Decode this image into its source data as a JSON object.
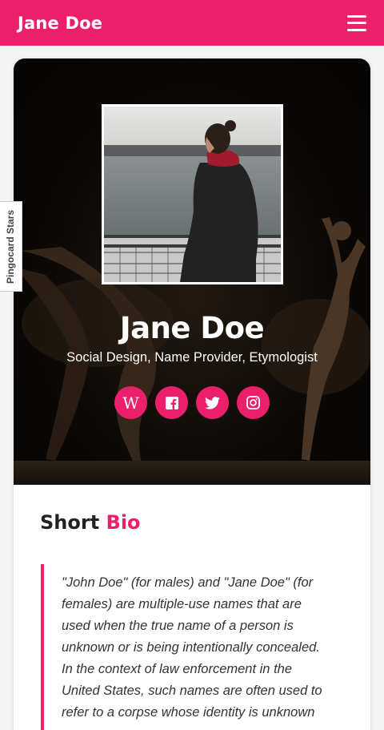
{
  "header": {
    "brand": "Jane Doe",
    "menu_icon": "hamburger-menu-icon"
  },
  "side_tab": {
    "label": "Pingocard Stars"
  },
  "profile": {
    "name": "Jane Doe",
    "tagline": "Social Design, Name Provider, Etymologist",
    "socials": [
      {
        "icon": "wikipedia-icon",
        "glyph": "W"
      },
      {
        "icon": "facebook-icon"
      },
      {
        "icon": "twitter-icon"
      },
      {
        "icon": "instagram-icon"
      }
    ]
  },
  "bio": {
    "title_main": "Short",
    "title_accent": "Bio",
    "text": "\"John Doe\" (for males) and \"Jane Doe\" (for females) are multiple-use names that are used when the true name of a person is unknown or is being intentionally concealed. In the context of law enforcement in the United States, such names are often used to refer to a corpse whose identity is unknown"
  },
  "colors": {
    "accent": "#ec1f6b",
    "hero_bg": "#0c0907",
    "page_bg": "#f4f4f4"
  }
}
